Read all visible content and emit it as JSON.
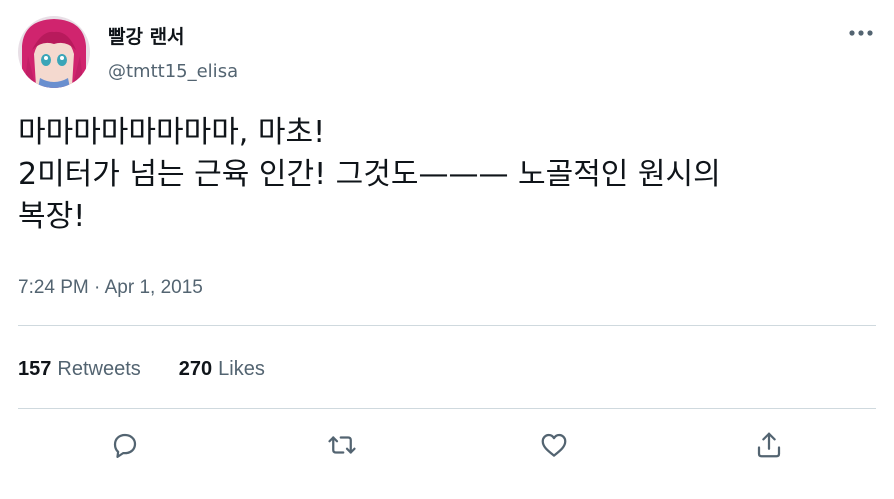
{
  "user": {
    "display_name": "빨강 랜서",
    "handle": "@tmtt15_elisa",
    "avatar_icon": "avatar-image"
  },
  "tweet": {
    "text": "마마마마마마마마, 마초!\n2미터가 넘는 근육 인간! 그것도——— 노골적인 원시의\n복장!",
    "timestamp": "7:24 PM · Apr 1, 2015"
  },
  "stats": {
    "retweets_count": "157",
    "retweets_label": "Retweets",
    "likes_count": "270",
    "likes_label": "Likes"
  },
  "actions": {
    "reply_icon": "reply-icon",
    "retweet_icon": "retweet-icon",
    "like_icon": "like-icon",
    "share_icon": "share-icon",
    "more_icon": "more-icon"
  },
  "colors": {
    "primary_text": "#0f1419",
    "secondary_text": "#536471",
    "divider": "#cfd9de",
    "icon": "#536471"
  }
}
